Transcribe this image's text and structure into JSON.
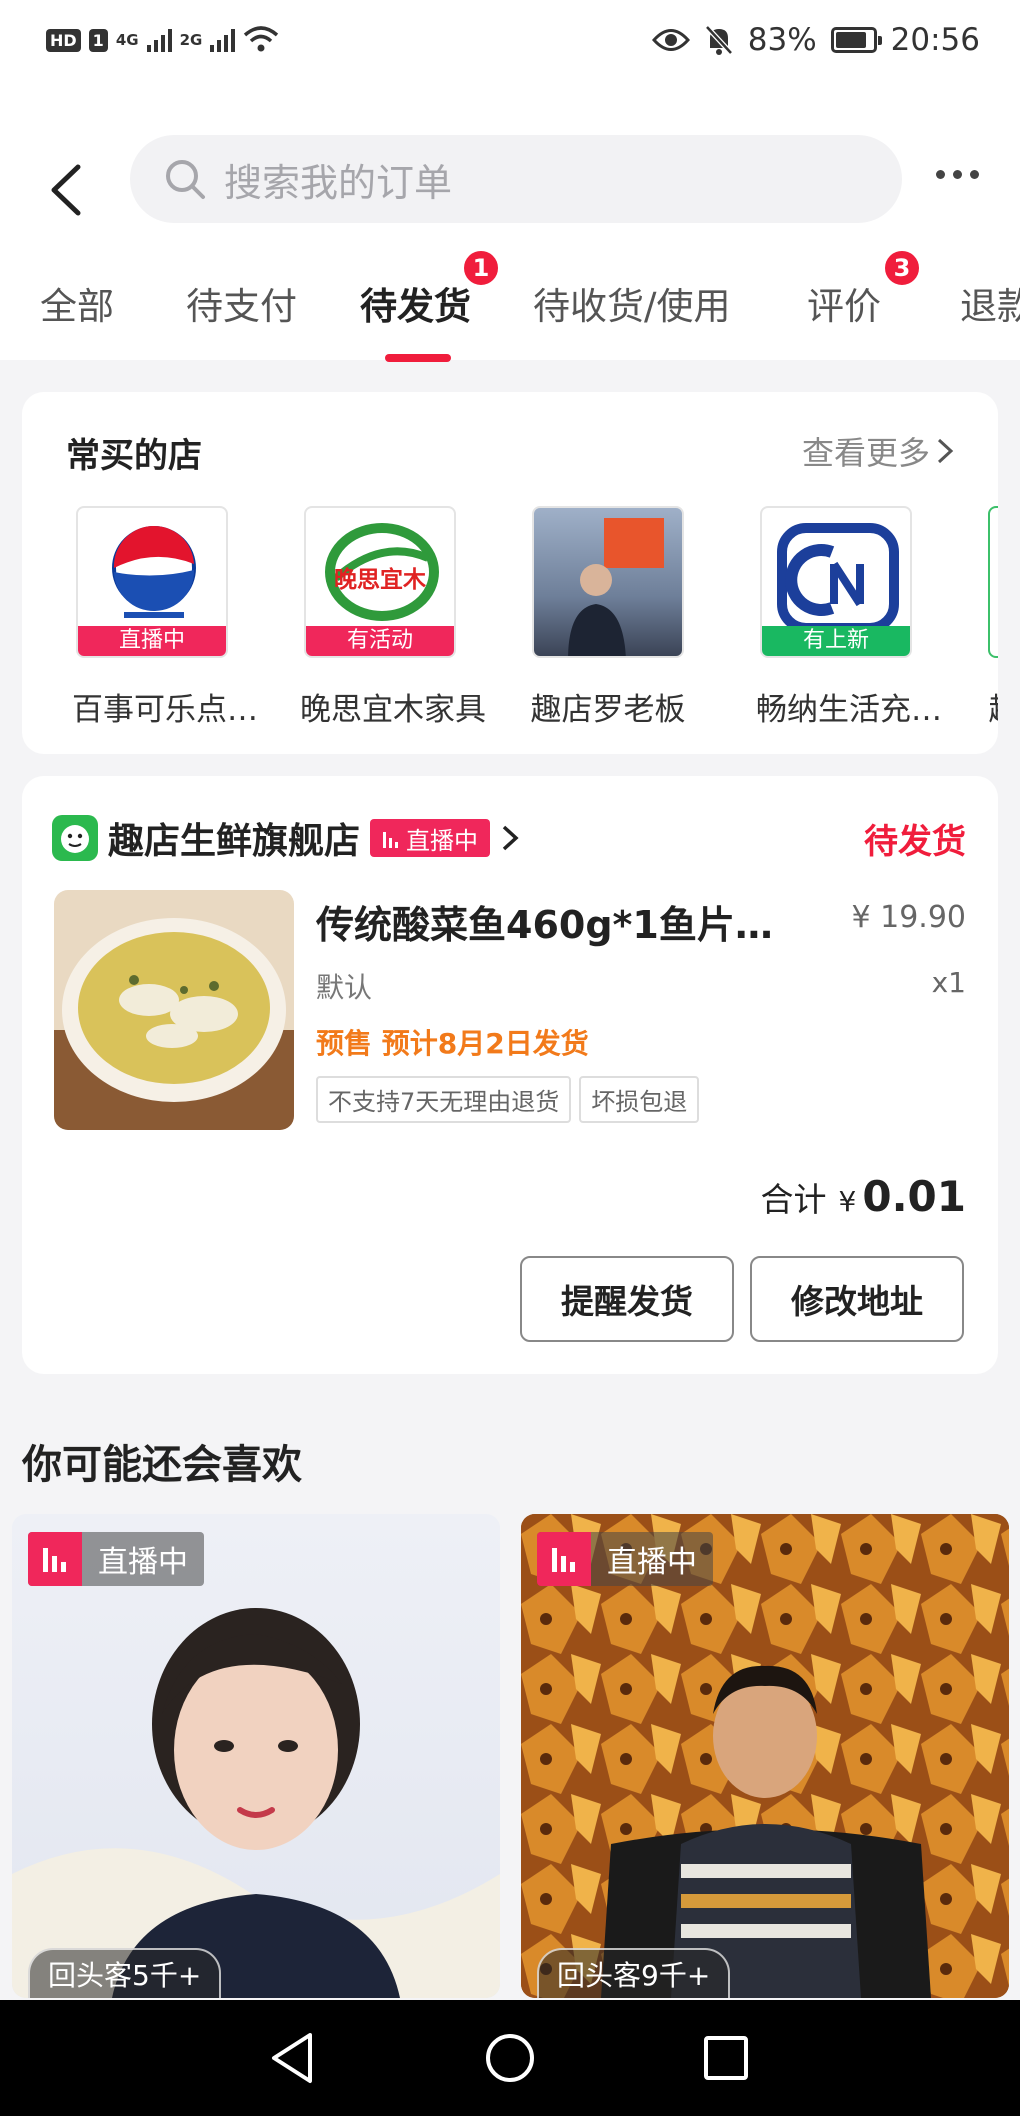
{
  "status_bar": {
    "left_badges": [
      "HD",
      "1"
    ],
    "network_1": "4G",
    "network_2": "2G",
    "battery": "83%",
    "time": "20:56"
  },
  "header": {
    "search_placeholder": "搜索我的订单"
  },
  "tabs": [
    {
      "label": "全部"
    },
    {
      "label": "待支付"
    },
    {
      "label": "待发货",
      "badge": "1",
      "active": true
    },
    {
      "label": "待收货/使用"
    },
    {
      "label": "评价",
      "badge": "3"
    },
    {
      "label": "退款"
    }
  ],
  "frequent_stores": {
    "title": "常买的店",
    "more": "查看更多",
    "stores": [
      {
        "name": "百事可乐点…",
        "tag": "直播中",
        "tag_color": "#f0275b"
      },
      {
        "name": "晚思宜木家具",
        "tag": "有活动",
        "tag_color": "#f0275b",
        "logo_text": "晚思宜木"
      },
      {
        "name": "趣店罗老板",
        "tag": ""
      },
      {
        "name": "畅纳生活充…",
        "tag": "有上新",
        "tag_color": "#19b861"
      },
      {
        "name": "趣",
        "tag": ""
      }
    ]
  },
  "order": {
    "shop_name": "趣店生鲜旗舰店",
    "live_tag": "直播中",
    "status": "待发货",
    "product_title": "传统酸菜鱼460g*1鱼片…",
    "price": "¥ 19.90",
    "spec": "默认",
    "qty": "x1",
    "presale": "预售 预计8月2日发货",
    "tags": [
      "不支持7天无理由退货",
      "坏损包退"
    ],
    "total_label": "合计",
    "total_currency": "¥",
    "total_value": "0.01",
    "buttons": {
      "remind": "提醒发货",
      "change_address": "修改地址"
    }
  },
  "recommendations": {
    "title": "你可能还会喜欢",
    "items": [
      {
        "live_label": "直播中",
        "returning": "回头客5千+"
      },
      {
        "live_label": "直播中",
        "returning": "回头客9千+"
      }
    ]
  },
  "colors": {
    "accent": "#f01d3c",
    "live_pink": "#f0275b",
    "presale_orange": "#f27a1a"
  }
}
